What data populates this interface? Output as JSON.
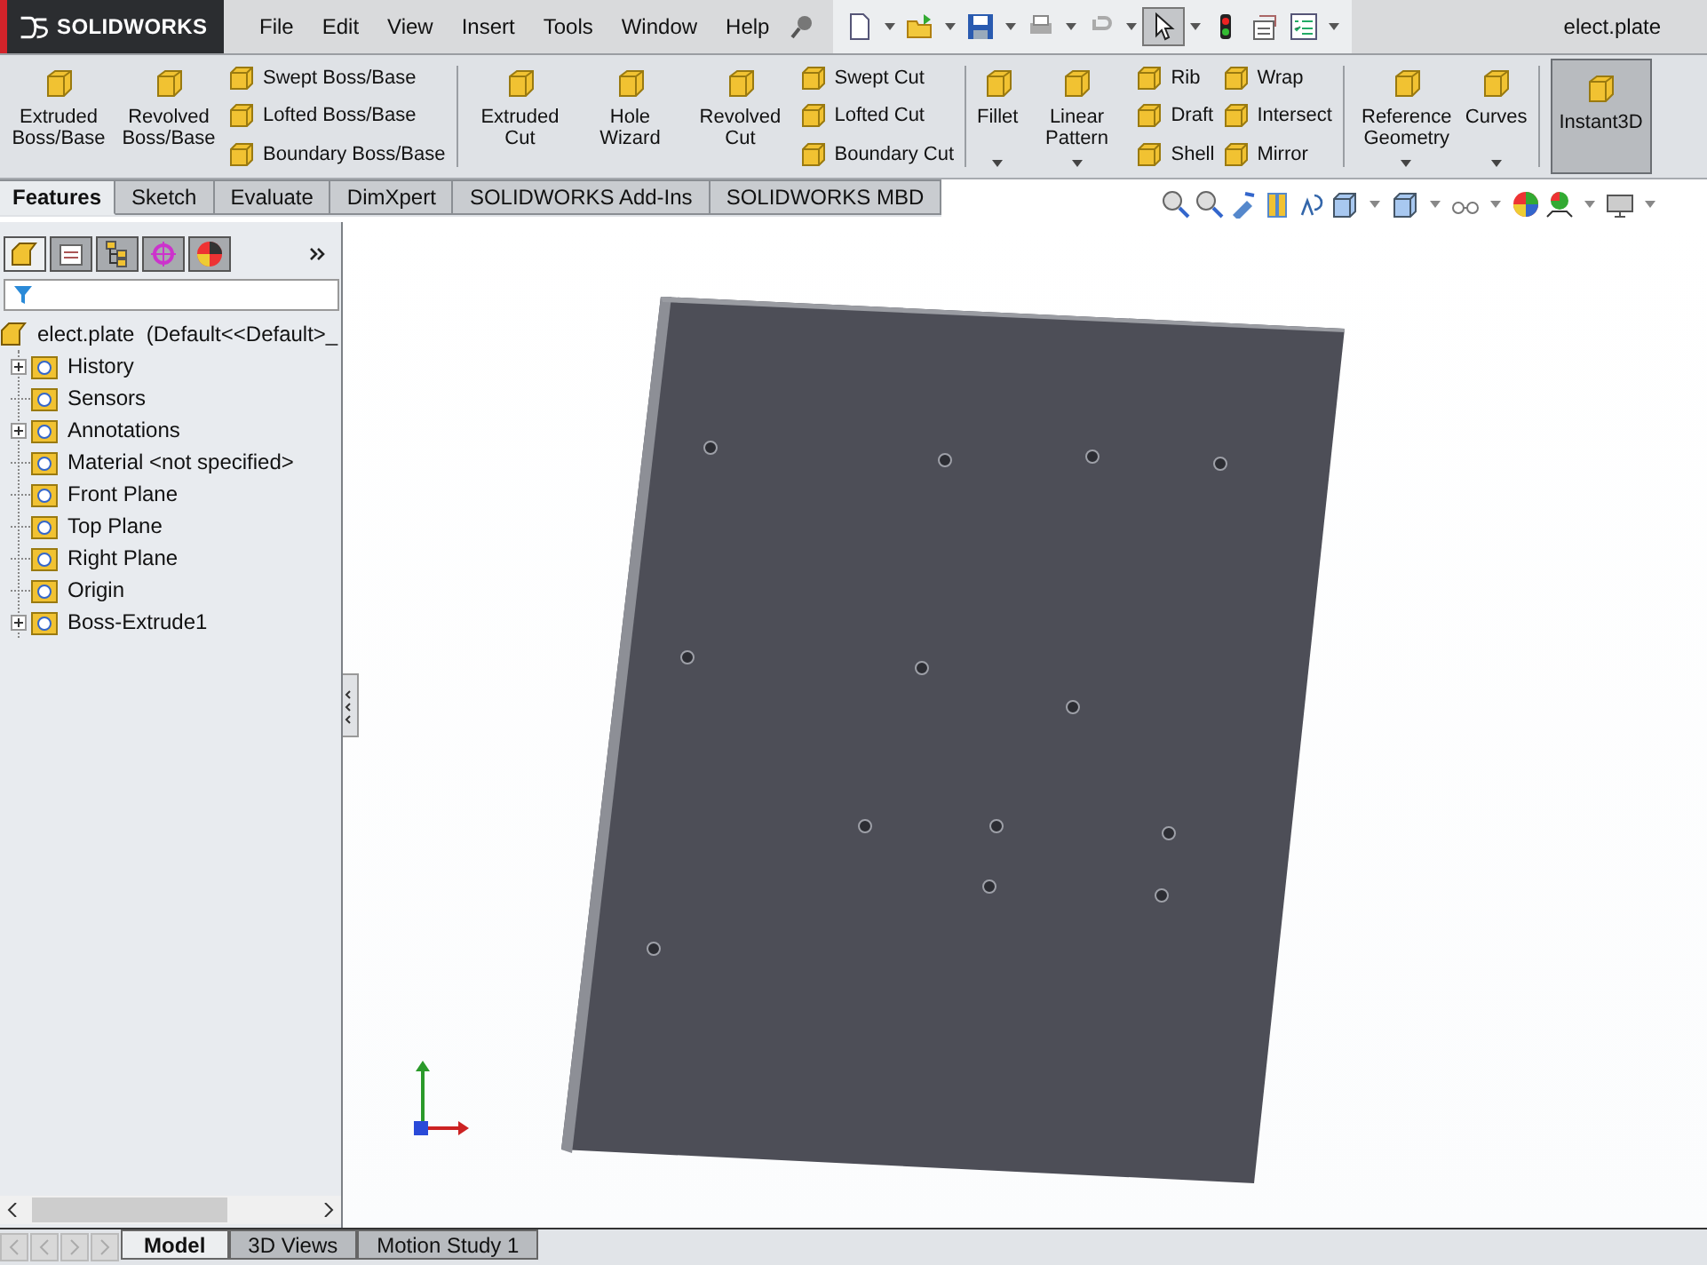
{
  "app": {
    "logo": "SOLIDWORKS",
    "menu": [
      "File",
      "Edit",
      "View",
      "Insert",
      "Tools",
      "Window",
      "Help"
    ],
    "document_title": "elect.plate"
  },
  "ribbon": [
    {
      "kind": "large",
      "label": "Extruded Boss/Base",
      "dropdown": false,
      "selected": false
    },
    {
      "kind": "large",
      "label": "Revolved Boss/Base",
      "dropdown": false,
      "selected": false
    },
    {
      "kind": "stack",
      "items": [
        "Swept Boss/Base",
        "Lofted Boss/Base",
        "Boundary Boss/Base"
      ]
    },
    {
      "kind": "separator"
    },
    {
      "kind": "large",
      "label": "Extruded Cut",
      "dropdown": false,
      "selected": false
    },
    {
      "kind": "large",
      "label": "Hole Wizard",
      "dropdown": false,
      "selected": false
    },
    {
      "kind": "large",
      "label": "Revolved Cut",
      "dropdown": false,
      "selected": false
    },
    {
      "kind": "stack",
      "items": [
        "Swept Cut",
        "Lofted Cut",
        "Boundary Cut"
      ]
    },
    {
      "kind": "separator"
    },
    {
      "kind": "large",
      "label": "Fillet",
      "dropdown": true,
      "selected": false
    },
    {
      "kind": "large",
      "label": "Linear Pattern",
      "dropdown": true,
      "selected": false
    },
    {
      "kind": "stack",
      "items": [
        "Rib",
        "Draft",
        "Shell"
      ]
    },
    {
      "kind": "stack",
      "items": [
        "Wrap",
        "Intersect",
        "Mirror"
      ]
    },
    {
      "kind": "separator"
    },
    {
      "kind": "large",
      "label": "Reference Geometry",
      "dropdown": true,
      "selected": false
    },
    {
      "kind": "large",
      "label": "Curves",
      "dropdown": true,
      "selected": false
    },
    {
      "kind": "separator"
    },
    {
      "kind": "large",
      "label": "Instant3D",
      "dropdown": false,
      "selected": true
    }
  ],
  "command_tabs": [
    {
      "label": "Features",
      "selected": true
    },
    {
      "label": "Sketch",
      "selected": false
    },
    {
      "label": "Evaluate",
      "selected": false
    },
    {
      "label": "DimXpert",
      "selected": false
    },
    {
      "label": "SOLIDWORKS Add-Ins",
      "selected": false
    },
    {
      "label": "SOLIDWORKS MBD",
      "selected": false
    }
  ],
  "manager_tabs": [
    {
      "selected": true
    },
    {
      "selected": false
    },
    {
      "selected": false
    },
    {
      "selected": false
    },
    {
      "selected": false
    }
  ],
  "tree": {
    "root": "elect.plate  (Default<<Default>_",
    "children": [
      {
        "label": "History",
        "has_children": true
      },
      {
        "label": "Sensors",
        "has_children": false
      },
      {
        "label": "Annotations",
        "has_children": true
      },
      {
        "label": "Material <not specified>",
        "has_children": false
      },
      {
        "label": "Front Plane",
        "has_children": false
      },
      {
        "label": "Top Plane",
        "has_children": false
      },
      {
        "label": "Right Plane",
        "has_children": false
      },
      {
        "label": "Origin",
        "has_children": false
      },
      {
        "label": "Boss-Extrude1",
        "has_children": true
      }
    ]
  },
  "bottom_tabs": [
    {
      "label": "Model",
      "selected": true
    },
    {
      "label": "3D Views",
      "selected": false
    },
    {
      "label": "Motion Study 1",
      "selected": false
    }
  ]
}
